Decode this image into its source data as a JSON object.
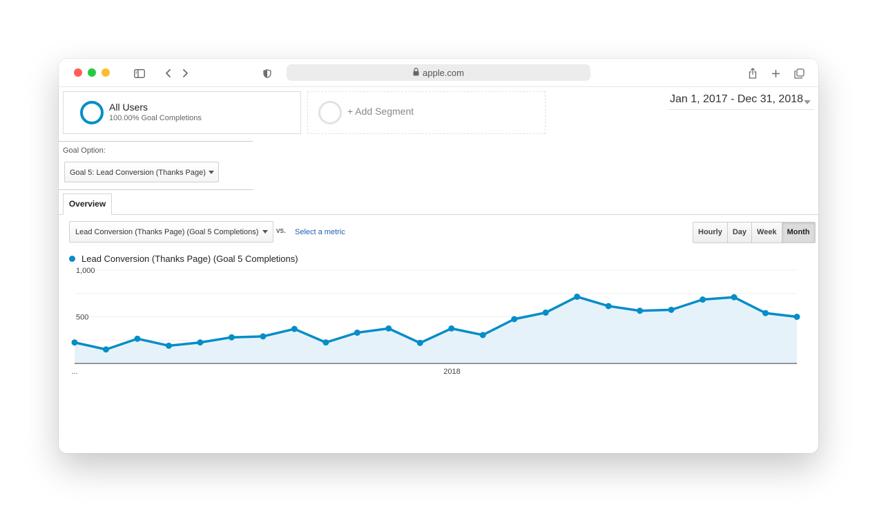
{
  "browser": {
    "url": "apple.com",
    "traffic_lights": [
      "#ff5f57",
      "#28c840",
      "#febc2e"
    ]
  },
  "segments": {
    "all_users": {
      "title": "All Users",
      "subtitle": "100.00% Goal Completions"
    },
    "add_segment": {
      "label": "+ Add Segment"
    }
  },
  "date_range": "Jan 1, 2017 - Dec 31, 2018",
  "goal": {
    "label": "Goal Option:",
    "selected": "Goal 5: Lead Conversion (Thanks Page)"
  },
  "tabs": [
    {
      "label": "Overview"
    }
  ],
  "metric": {
    "selected": "Lead Conversion (Thanks Page) (Goal 5 Completions)",
    "vs_label": "vs.",
    "select_metric_label": "Select a metric"
  },
  "granularity": {
    "options": [
      "Hourly",
      "Day",
      "Week",
      "Month"
    ],
    "active": "Month"
  },
  "colors": {
    "series": "#058dc7",
    "area": "#e6f2fa"
  },
  "chart_data": {
    "type": "area",
    "series": [
      {
        "name": "Lead Conversion (Thanks Page) (Goal 5 Completions)",
        "values": [
          225,
          150,
          265,
          190,
          225,
          280,
          290,
          370,
          225,
          330,
          375,
          220,
          375,
          305,
          475,
          545,
          715,
          615,
          565,
          575,
          685,
          710,
          540,
          500
        ]
      }
    ],
    "x_tick_labels": [
      "...",
      "2018"
    ],
    "y_tick_labels": [
      "1,000",
      "500"
    ],
    "ylim": [
      0,
      1000
    ],
    "grid": true
  }
}
